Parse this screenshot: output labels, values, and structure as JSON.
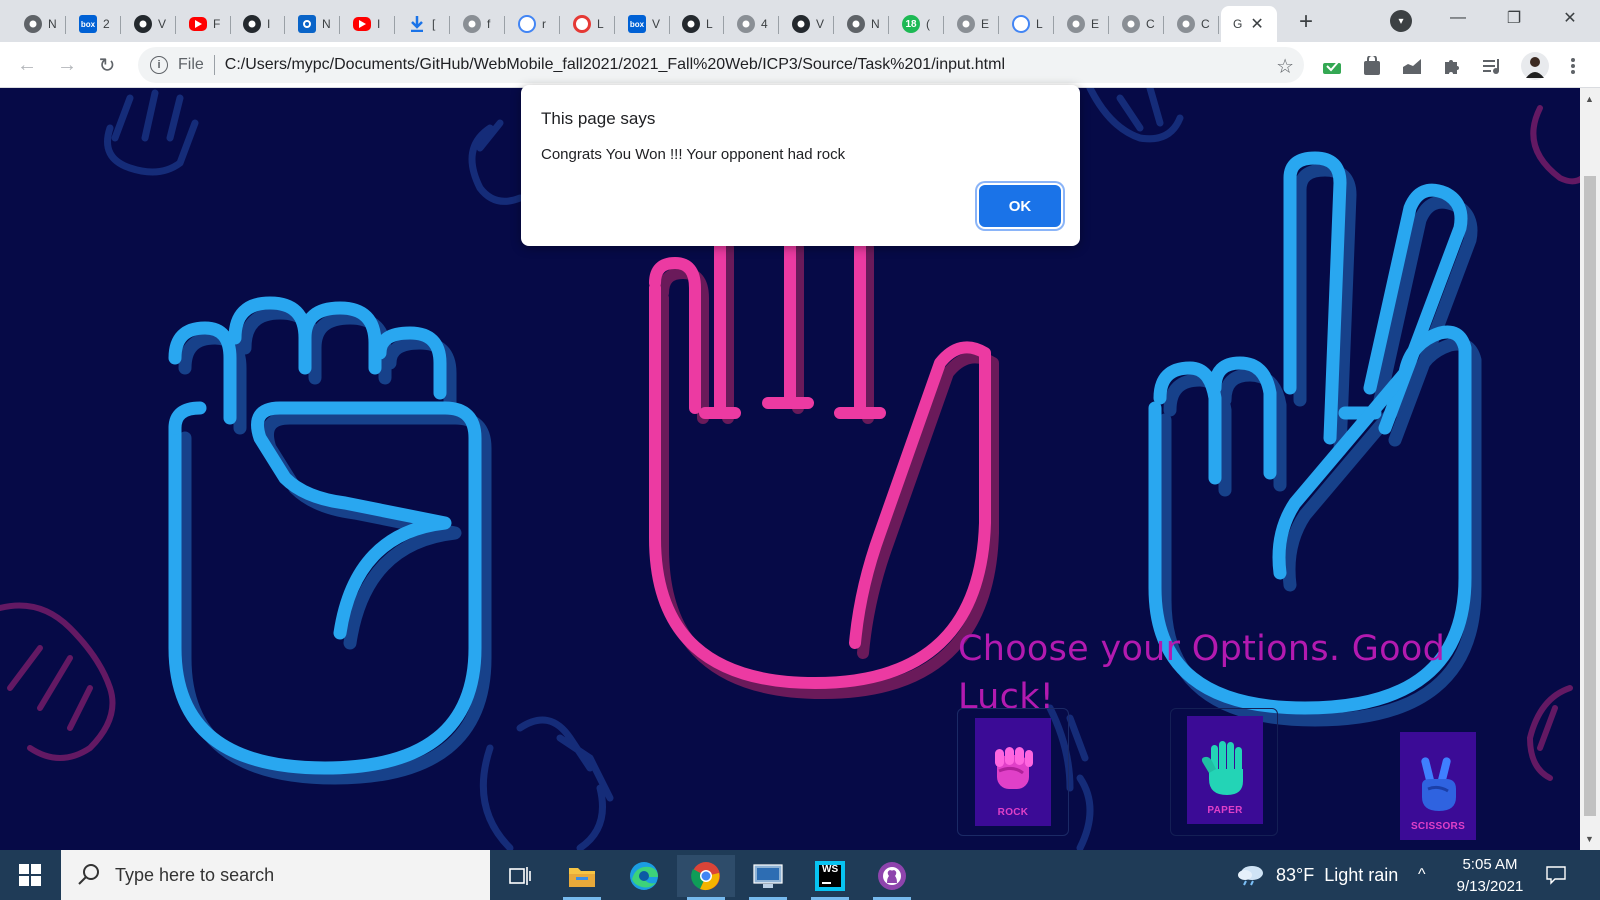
{
  "browser": {
    "tabs": [
      {
        "fav": "chrome-icon",
        "color": "#5f6368",
        "title": "N"
      },
      {
        "fav": "box-icon",
        "color": "#0061d5",
        "title": "2"
      },
      {
        "fav": "github-icon",
        "color": "#24292e",
        "title": "V"
      },
      {
        "fav": "youtube-icon",
        "color": "#ff0000",
        "title": "F"
      },
      {
        "fav": "github-icon",
        "color": "#24292e",
        "title": "I"
      },
      {
        "fav": "outlook-icon",
        "color": "#0a64c8",
        "title": "N"
      },
      {
        "fav": "youtube-icon",
        "color": "#ff0000",
        "title": "I"
      },
      {
        "fav": "download-icon",
        "color": "#1a73e8",
        "title": "["
      },
      {
        "fav": "globe-icon",
        "color": "#8a8f95",
        "title": "f"
      },
      {
        "fav": "google-icon",
        "color": "#4285f4",
        "title": "r"
      },
      {
        "fav": "wheel-icon",
        "color": "#e53935",
        "title": "L"
      },
      {
        "fav": "box-icon",
        "color": "#0061d5",
        "title": "V"
      },
      {
        "fav": "github-icon",
        "color": "#24292e",
        "title": "L"
      },
      {
        "fav": "globe-icon",
        "color": "#8a8f95",
        "title": "4"
      },
      {
        "fav": "github-icon",
        "color": "#24292e",
        "title": "V"
      },
      {
        "fav": "chrome-icon",
        "color": "#5f6368",
        "title": "N"
      },
      {
        "fav": "badge-18-icon",
        "color": "#1db954",
        "title": "("
      },
      {
        "fav": "globe-icon",
        "color": "#8a8f95",
        "title": "E"
      },
      {
        "fav": "google-icon",
        "color": "#4285f4",
        "title": "L"
      },
      {
        "fav": "globe-icon",
        "color": "#8a8f95",
        "title": "E"
      },
      {
        "fav": "globe-icon",
        "color": "#8a8f95",
        "title": "C"
      },
      {
        "fav": "globe-icon",
        "color": "#8a8f95",
        "title": "C"
      }
    ],
    "active_tab": {
      "title": "G",
      "close": "✕"
    },
    "new_tab": "+",
    "badge_18": "18",
    "box_text": "box",
    "tab_search": "▾",
    "window": {
      "minimize": "—",
      "restore": "❐",
      "close": "✕"
    },
    "nav": {
      "back": "←",
      "forward": "→",
      "reload": "↻"
    },
    "address": {
      "info": "i",
      "scheme": "File",
      "url": "C:/Users/mypc/Documents/GitHub/WebMobile_fall2021/2021_Fall%20Web/ICP3/Source/Task%201/input.html",
      "star": "☆"
    },
    "extensions": [
      "check-icon",
      "bag-icon",
      "chart-icon",
      "puzzle-icon",
      "media-icon",
      "profile-avatar",
      "menu-icon"
    ]
  },
  "page": {
    "heading": "Choose your Options. Good Luck!",
    "options": [
      {
        "label": "ROCK",
        "icon": "rock-hand-icon"
      },
      {
        "label": "PAPER",
        "icon": "paper-hand-icon"
      },
      {
        "label": "SCISSORS",
        "icon": "scissors-hand-icon"
      }
    ],
    "colors": {
      "background": "#060a47",
      "blue_hand": "#29a7f0",
      "pink_hand": "#ec3aa2",
      "heading": "#b31ab0"
    }
  },
  "dialog": {
    "title": "This page says",
    "message": "Congrats You Won !!! Your opponent had rock",
    "ok_label": "OK"
  },
  "taskbar": {
    "search_placeholder": "Type here to search",
    "apps": [
      "task-view-icon",
      "file-explorer-icon",
      "edge-icon",
      "chrome-icon",
      "remote-desktop-icon",
      "webstorm-icon",
      "github-desktop-icon"
    ],
    "webstorm_label": "WS",
    "weather": {
      "temp": "83°F",
      "condition": "Light rain"
    },
    "tray_chevron": "^",
    "time": "5:05 AM",
    "date": "9/13/2021"
  }
}
